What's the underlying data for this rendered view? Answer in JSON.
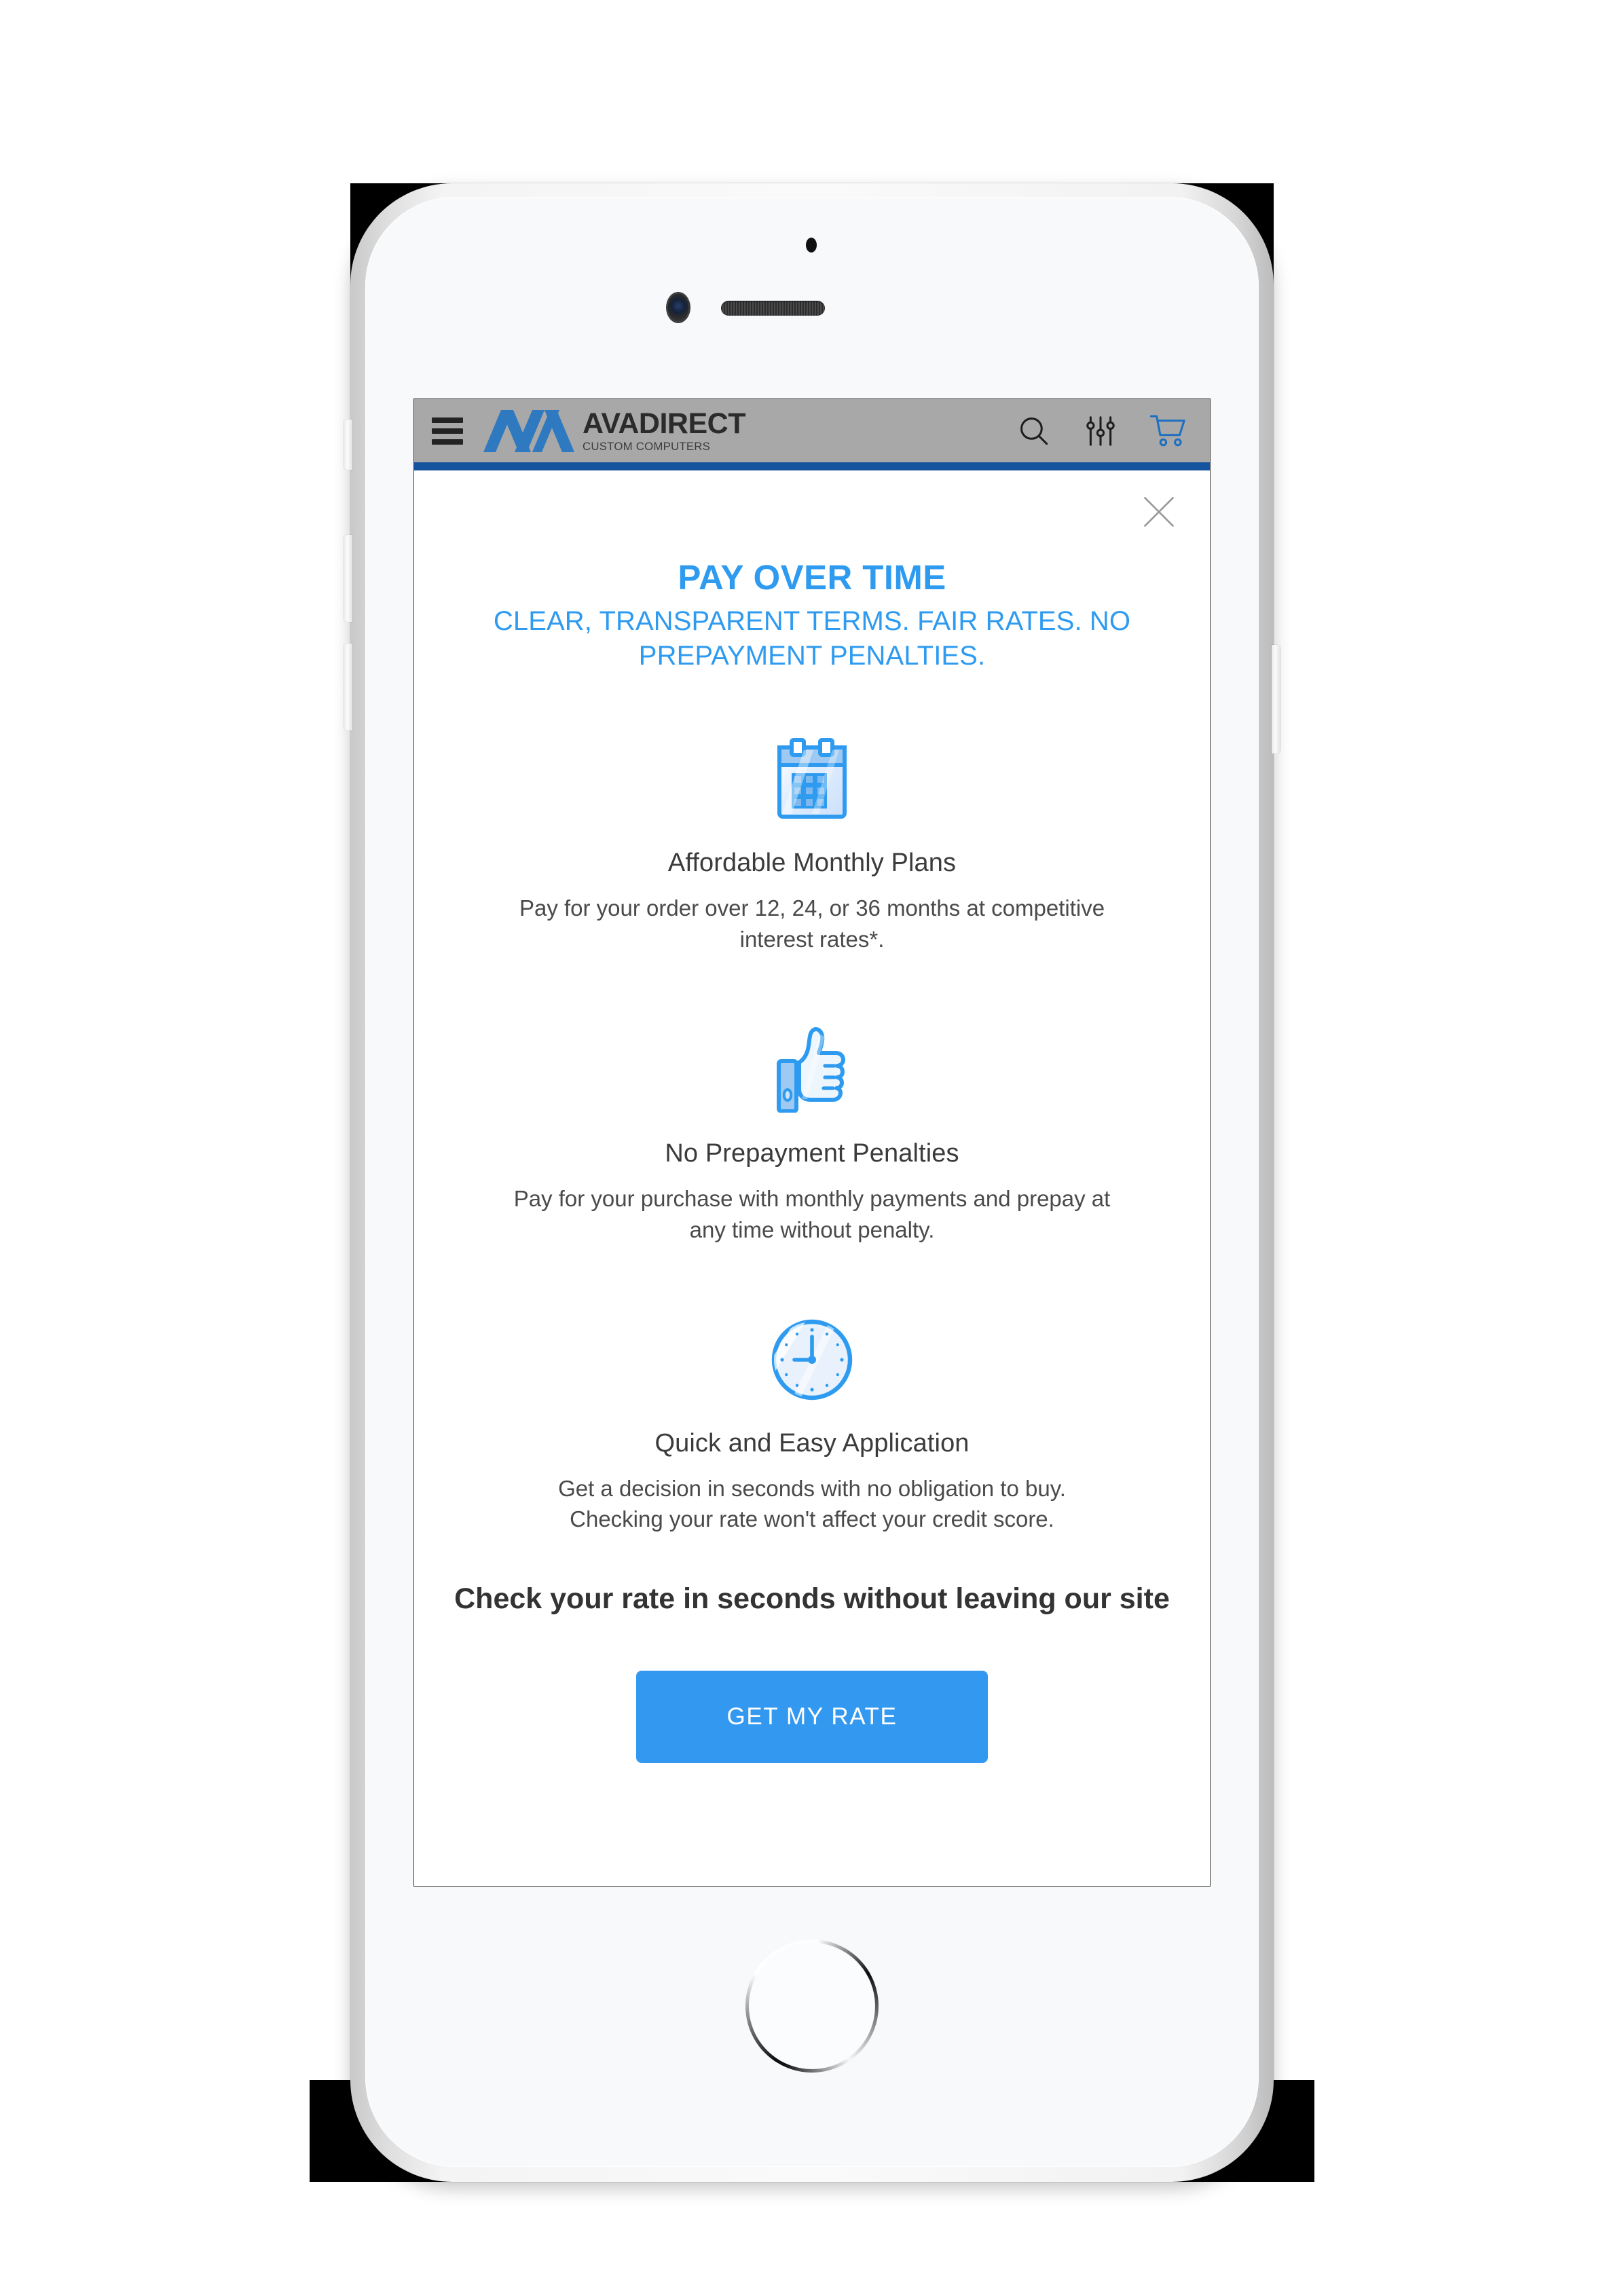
{
  "site_header": {
    "menu_icon": "hamburger-menu-icon",
    "brand_name": "AVADIRECT",
    "brand_tagline": "CUSTOM COMPUTERS",
    "logo_mark": "ava-chevron-logo",
    "actions": [
      {
        "name": "search-icon",
        "label": "Search"
      },
      {
        "name": "filter-sliders-icon",
        "label": "Filters"
      },
      {
        "name": "shopping-cart-icon",
        "label": "Cart"
      }
    ]
  },
  "modal": {
    "close_icon": "close-x-icon",
    "title": "PAY OVER TIME",
    "subtitle": "CLEAR, TRANSPARENT TERMS. FAIR RATES. NO PREPAYMENT PENALTIES.",
    "features": [
      {
        "icon": "calendar-icon",
        "title": "Affordable Monthly Plans",
        "description": "Pay for your order over 12, 24, or 36 months at competitive interest rates*."
      },
      {
        "icon": "thumbs-up-icon",
        "title": "No Prepayment Penalties",
        "description": "Pay for your purchase with monthly payments and prepay at any time without penalty."
      },
      {
        "icon": "clock-icon",
        "title": "Quick and Easy Application",
        "description": "Get a decision in seconds with no obligation to buy. Checking your rate won't affect your credit score."
      }
    ],
    "cta_headline": "Check your rate in seconds without leaving our site",
    "cta_button_label": "GET MY RATE"
  },
  "device": {
    "frame": "iphone-white-frame",
    "home_button": "home-button",
    "front_camera": "front-camera",
    "earpiece": "earpiece-speaker",
    "sensor": "proximity-sensor"
  },
  "colors": {
    "brand_blue": "#2e9bf0",
    "button_blue": "#3399f0",
    "logo_blue": "#2e79c0",
    "header_gray": "#a8a8a8",
    "header_accent": "#15539e"
  }
}
